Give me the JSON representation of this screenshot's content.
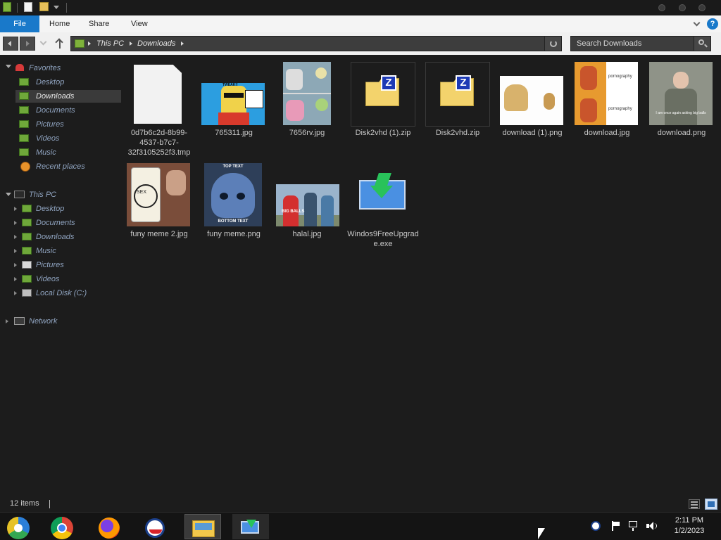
{
  "ribbon": {
    "tabs": [
      "File",
      "Home",
      "Share",
      "View"
    ]
  },
  "address": {
    "crumbs": [
      "This PC",
      "Downloads"
    ],
    "search_placeholder": "Search Downloads"
  },
  "sidebar": {
    "favorites": {
      "label": "Favorites",
      "items": [
        "Desktop",
        "Downloads",
        "Documents",
        "Pictures",
        "Videos",
        "Music",
        "Recent places"
      ]
    },
    "thispc": {
      "label": "This PC",
      "items": [
        "Desktop",
        "Documents",
        "Downloads",
        "Music",
        "Pictures",
        "Videos",
        "Local Disk (C:)"
      ]
    },
    "network": {
      "label": "Network"
    }
  },
  "files": [
    {
      "name": "0d7b6c2d-8b99-4537-b7c7-32f3105252f3.tmp",
      "kind": "blank-document-icon"
    },
    {
      "name": "765311.jpg",
      "kind": "meme-image-thumbnail",
      "text": "TWEAK!!"
    },
    {
      "name": "7656rv.jpg",
      "kind": "meme-image-thumbnail"
    },
    {
      "name": "Disk2vhd (1).zip",
      "kind": "zip-folder-icon"
    },
    {
      "name": "Disk2vhd.zip",
      "kind": "zip-folder-icon"
    },
    {
      "name": "download (1).png",
      "kind": "meme-image-thumbnail"
    },
    {
      "name": "download.jpg",
      "kind": "meme-image-thumbnail",
      "text": "pornography"
    },
    {
      "name": "download.png",
      "kind": "meme-image-thumbnail",
      "text": "I am once again asking big balls"
    },
    {
      "name": "funy meme 2.jpg",
      "kind": "meme-image-thumbnail",
      "text": "SEX"
    },
    {
      "name": "funy meme.png",
      "kind": "meme-image-thumbnail",
      "text_top": "TOP TEXT",
      "text_bottom": "BOTTOM TEXT"
    },
    {
      "name": "halal.jpg",
      "kind": "meme-image-thumbnail",
      "text": "BIG BALLS"
    },
    {
      "name": "Windos9FreeUpgrade.exe",
      "kind": "installer-icon"
    }
  ],
  "status": {
    "count": "12 items"
  },
  "taskbar": {
    "time": "2:11 PM",
    "date": "1/2/2023"
  },
  "colors": {
    "file_tab": "#1979ca",
    "window_bg": "#1c1c1c",
    "sidebar_text": "#8fa3bf",
    "taskbar_bg": "#141414"
  }
}
